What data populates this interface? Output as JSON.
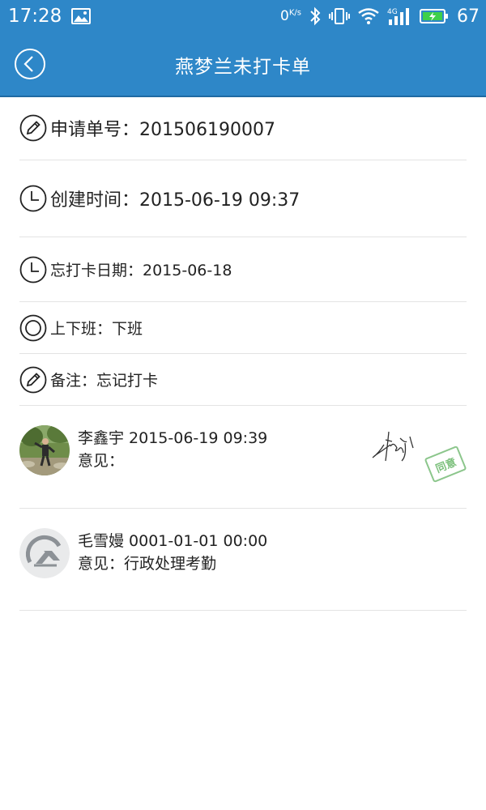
{
  "status_bar": {
    "time": "17:28",
    "network_speed": "0",
    "network_speed_unit": "K/s",
    "signal_type": "4G",
    "battery": "67",
    "icons": [
      "gallery-icon",
      "bluetooth-icon",
      "vibrate-icon",
      "wifi-icon",
      "cell-signal-icon",
      "battery-charging-icon"
    ]
  },
  "header": {
    "title": "燕梦兰未打卡单",
    "back_icon": "back-circle-icon"
  },
  "details": {
    "request_no": "申请单号：201506190007",
    "created_time": "创建时间：2015-06-19   09:37",
    "forgot_date": "忘打卡日期：2015-06-18",
    "shift": "上下班：下班",
    "remark": "备注：忘记打卡"
  },
  "approvals": [
    {
      "name_time": "李鑫宇 2015-06-19   09:39",
      "opinion": "意见：",
      "stamp": "同意",
      "stamp_color": "#7cc07c"
    },
    {
      "name_time": "毛雪嫚 0001-01-01   00:00",
      "opinion": "意见：行政处理考勤"
    }
  ],
  "colors": {
    "header_bg": "#2e87c8",
    "divider": "#e3e3e3"
  }
}
